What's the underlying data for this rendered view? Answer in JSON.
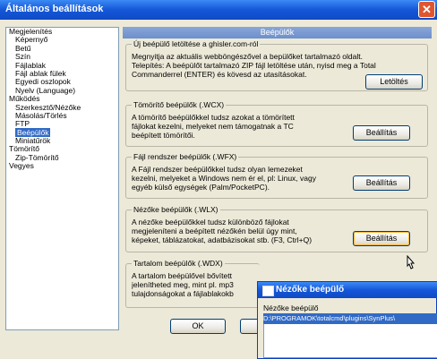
{
  "window": {
    "title": "Általános beállítások",
    "close_glyph": "✕"
  },
  "tree": {
    "items": [
      {
        "label": "Megjelenítés",
        "level": 1
      },
      {
        "label": "Képernyő",
        "level": 2
      },
      {
        "label": "Betű",
        "level": 2
      },
      {
        "label": "Szín",
        "level": 2
      },
      {
        "label": "Fájlablak",
        "level": 2
      },
      {
        "label": "Fájl ablak fülek",
        "level": 2
      },
      {
        "label": "Egyedi oszlopok",
        "level": 2
      },
      {
        "label": "Nyelv (Language)",
        "level": 2
      },
      {
        "label": "Működés",
        "level": 1
      },
      {
        "label": "Szerkesztő/Nézőke",
        "level": 2
      },
      {
        "label": "Másolás/Törlés",
        "level": 2
      },
      {
        "label": "FTP",
        "level": 2
      },
      {
        "label": "Beépülők",
        "level": 2,
        "selected": true
      },
      {
        "label": "Miniatűrök",
        "level": 2
      },
      {
        "label": "Tömörítő",
        "level": 1
      },
      {
        "label": "Zip-Tömörítő",
        "level": 2
      },
      {
        "label": "Vegyes",
        "level": 1
      }
    ]
  },
  "panel": {
    "header": "Beépülők",
    "groups": [
      {
        "title": "Új beépülő letöltése a ghisler.com-ról",
        "lines": [
          "Megnyitja az aktuális webböngészővel a bepülőket tartalmazó oldalt.",
          "Telepítés: A beépülőt tartalmazó ZIP fájl letöltése után, nyisd meg a Total",
          "Commanderrel (ENTER) és kövesd az utasításokat."
        ],
        "button": "Letöltés"
      },
      {
        "title": "Tömörítő beépülők (.WCX)",
        "lines": [
          "A tömörítő beépülőkkel tudsz azokat a tömörített",
          "fájlokat kezelni, melyeket nem támogatnak a TC",
          "beépített tömörítői."
        ],
        "button": "Beállítás"
      },
      {
        "title": "Fájl rendszer beépülők (.WFX)",
        "lines": [
          "A Fájl rendszer beépülőkkel tudsz olyan lemezeket",
          "kezelni, melyeket a Windows nem ér el, pl: Linux, vagy",
          "egyéb külső egységek (Palm/PocketPC)."
        ],
        "button": "Beállítás"
      },
      {
        "title": "Nézőke beépülők (.WLX)",
        "lines": [
          "A nézőke beépülőkkel tudsz különböző fájlokat",
          "megjeleníteni a beépített nézőkén belül úgy mint,",
          "képeket, táblázatokat, adatbázisokat stb. (F3, Ctrl+Q)"
        ],
        "button": "Beállítás"
      },
      {
        "title": "Tartalom beépülők (.WDX)",
        "lines": [
          "A tartalom beépülővel bővített",
          "jelenítheted meg, mint pl. mp3",
          "tulajdonságokat a fájlablakokb"
        ],
        "button": ""
      }
    ],
    "ok_label": "OK"
  },
  "popup": {
    "title": "Nézőke beépülő",
    "label": "Nézőke beépülő",
    "path": "D:\\PROGRAMOK\\totalcmd\\plugins\\SynPlus\\"
  }
}
